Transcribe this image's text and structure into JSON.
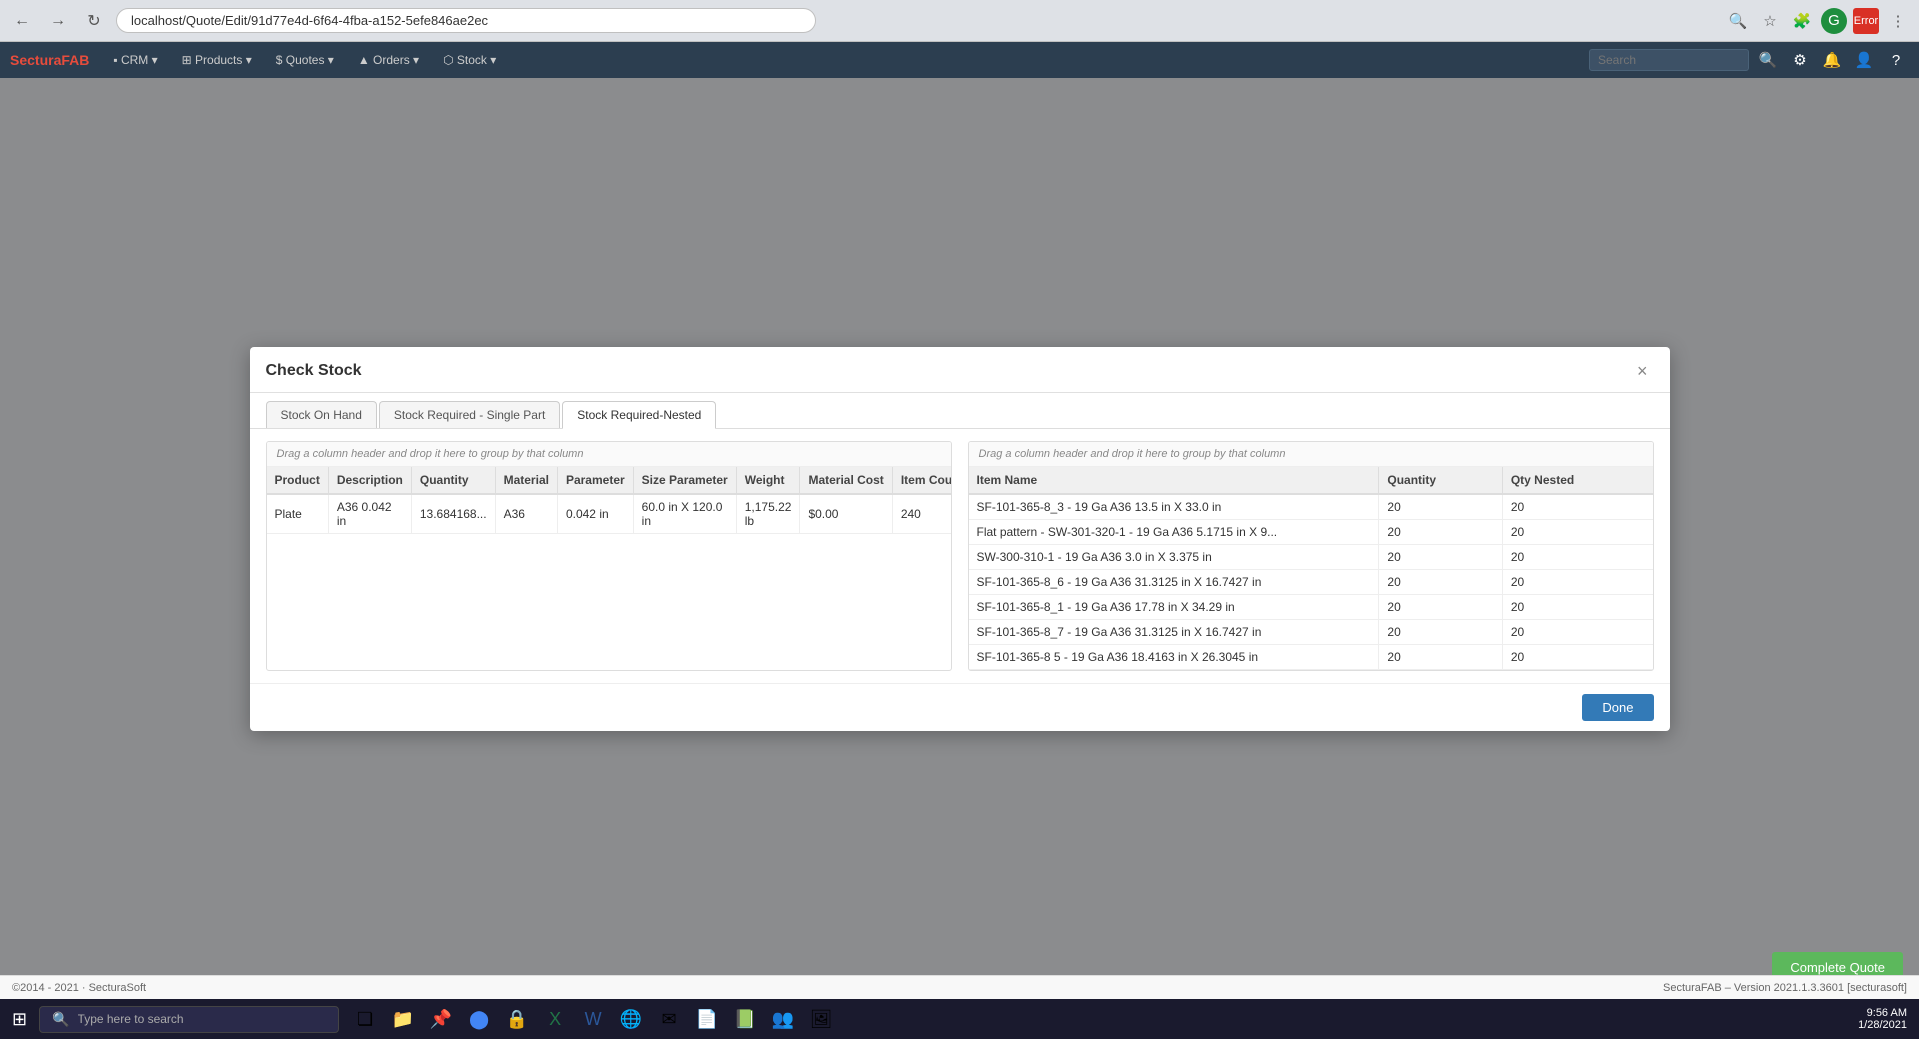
{
  "browser": {
    "url": "localhost/Quote/Edit/91d77e4d-6f64-4fba-a152-5efe846ae2ec",
    "error_badge": "Error"
  },
  "app": {
    "brand": "Sectura",
    "brand_highlight": "FAB",
    "nav_items": [
      "CRM",
      "Products",
      "$ Quotes",
      "Orders",
      "Stock"
    ],
    "search_placeholder": "Search"
  },
  "modal": {
    "title": "Check Stock",
    "close_label": "×",
    "tabs": [
      {
        "label": "Stock On Hand",
        "active": false
      },
      {
        "label": "Stock Required - Single Part",
        "active": false
      },
      {
        "label": "Stock Required-Nested",
        "active": true
      }
    ],
    "left_panel": {
      "hint": "Drag a column header and drop it here to group by that column",
      "columns": [
        "Product",
        "Description",
        "Quantity",
        "Material",
        "Parameter",
        "Size Parameter",
        "Weight",
        "Material Cost",
        "Item Count"
      ],
      "rows": [
        {
          "product": "Plate",
          "description": "A36 0.042 in",
          "quantity": "13.684168...",
          "material": "A36",
          "parameter": "0.042 in",
          "size_parameter": "60.0 in X 120.0 in",
          "weight": "1,175.22 lb",
          "material_cost": "$0.00",
          "item_count": "240"
        }
      ]
    },
    "right_panel": {
      "hint": "Drag a column header and drop it here to group by that column",
      "columns": [
        "Item Name",
        "Quantity",
        "Qty Nested"
      ],
      "rows": [
        {
          "item_name": "SF-101-365-8_3 - 19 Ga A36 13.5 in X 33.0 in",
          "quantity": "20",
          "qty_nested": "20"
        },
        {
          "item_name": "Flat pattern - SW-301-320-1 - 19 Ga A36 5.1715 in X 9...",
          "quantity": "20",
          "qty_nested": "20"
        },
        {
          "item_name": "SW-300-310-1 - 19 Ga A36 3.0 in X 3.375 in",
          "quantity": "20",
          "qty_nested": "20"
        },
        {
          "item_name": "SF-101-365-8_6 - 19 Ga A36 31.3125 in X 16.7427 in",
          "quantity": "20",
          "qty_nested": "20"
        },
        {
          "item_name": "SF-101-365-8_1 - 19 Ga A36 17.78 in X 34.29 in",
          "quantity": "20",
          "qty_nested": "20"
        },
        {
          "item_name": "SF-101-365-8_7 - 19 Ga A36 31.3125 in X 16.7427 in",
          "quantity": "20",
          "qty_nested": "20"
        },
        {
          "item_name": "SF-101-365-8  5 - 19 Ga A36 18.4163 in X 26.3045 in",
          "quantity": "20",
          "qty_nested": "20"
        }
      ]
    },
    "done_button": "Done"
  },
  "complete_quote_button": "Complete Quote",
  "version_bar": {
    "copyright": "©2014 - 2021 · SecturaSoft",
    "version": "SecturaFAB – Version 2021.1.3.3601 [secturasoft]"
  },
  "taskbar": {
    "search_placeholder": "Type here to search",
    "clock": {
      "time": "9:56 AM",
      "date": "1/28/2021"
    },
    "icons": [
      "⊞",
      "🔍",
      "❏",
      "📁",
      "📌",
      "🌐",
      "⬡",
      "W",
      "X",
      "🦊",
      "🔒",
      "📊",
      "W",
      "📄",
      "📗",
      "👥",
      "🖼"
    ]
  }
}
